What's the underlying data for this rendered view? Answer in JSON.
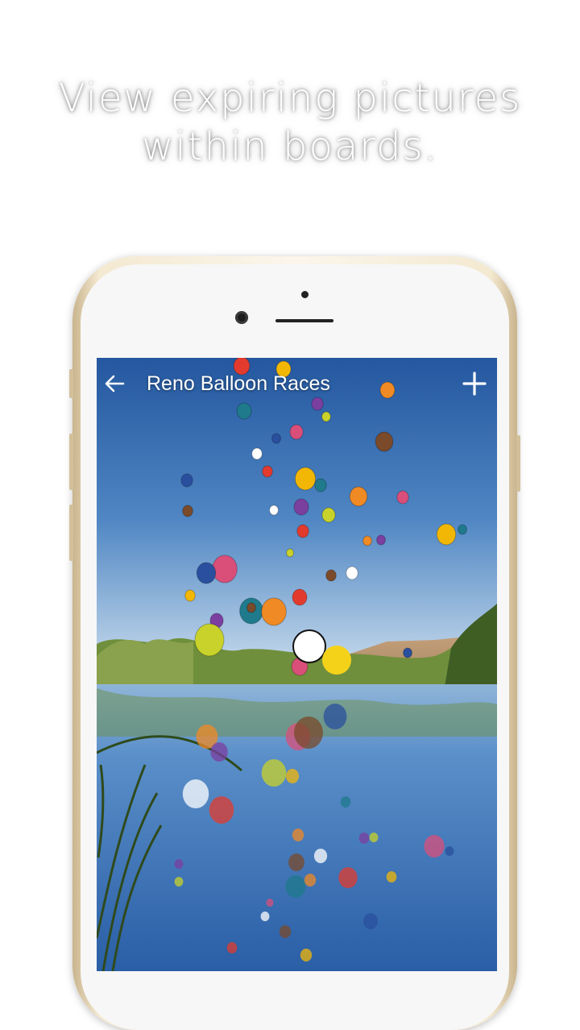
{
  "headline": {
    "line1": "View expiring pictures",
    "line2": "within boards."
  },
  "board": {
    "title": "Reno Balloon Races"
  },
  "icons": {
    "back": "arrow-left-icon",
    "add": "plus-icon"
  },
  "colors": {
    "sky_top": "#2d63a8",
    "sky_horizon": "#cfe0ef",
    "water": "#3a71b7",
    "phone_frame": "#f4e9d1",
    "headline_text": "#ffffff"
  }
}
